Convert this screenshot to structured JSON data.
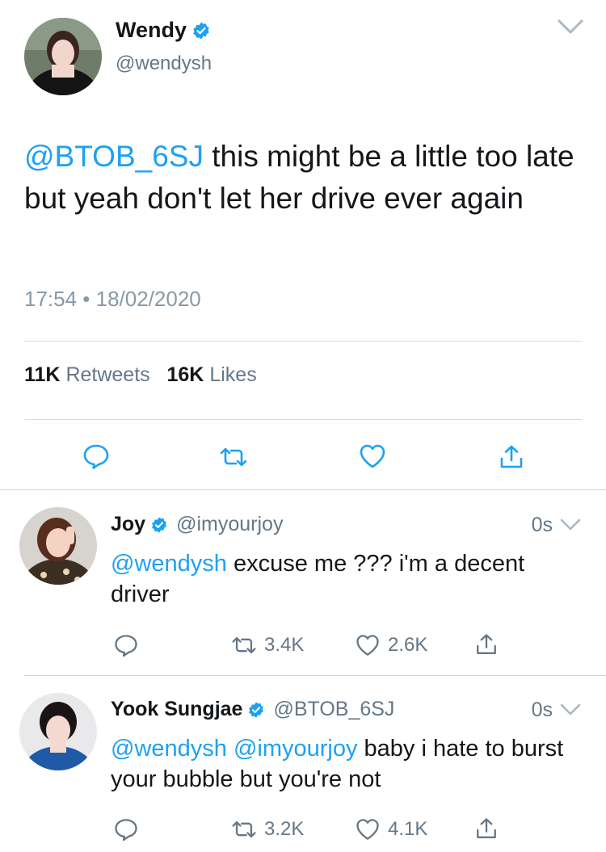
{
  "main_tweet": {
    "author_name": "Wendy",
    "author_handle": "@wendysh",
    "mention": "@BTOB_6SJ",
    "text": " this might be a little too late but yeah don't let her drive ever again",
    "timestamp": "17:54 • 18/02/2020",
    "retweets_count": "11K",
    "retweets_label": "Retweets",
    "likes_count": "16K",
    "likes_label": "Likes"
  },
  "replies": [
    {
      "name": "Joy",
      "handle": "@imyourjoy",
      "time": "0s",
      "mentions": "@wendysh",
      "text": " excuse me ??? i'm a decent driver",
      "retweets": "3.4K",
      "likes": "2.6K"
    },
    {
      "name": "Yook Sungjae",
      "handle": "@BTOB_6SJ",
      "time": "0s",
      "mentions": "@wendysh @imyourjoy",
      "text": " baby i hate to burst your bubble but you're not",
      "retweets": "3.2K",
      "likes": "4.1K"
    }
  ],
  "colors": {
    "accent": "#1da1f2",
    "text": "#14171a",
    "secondary": "#657786",
    "icon": "#1da1f2"
  },
  "icons": [
    "verified-badge-icon",
    "chevron-down-icon",
    "reply-icon",
    "retweet-icon",
    "like-icon",
    "share-icon"
  ]
}
